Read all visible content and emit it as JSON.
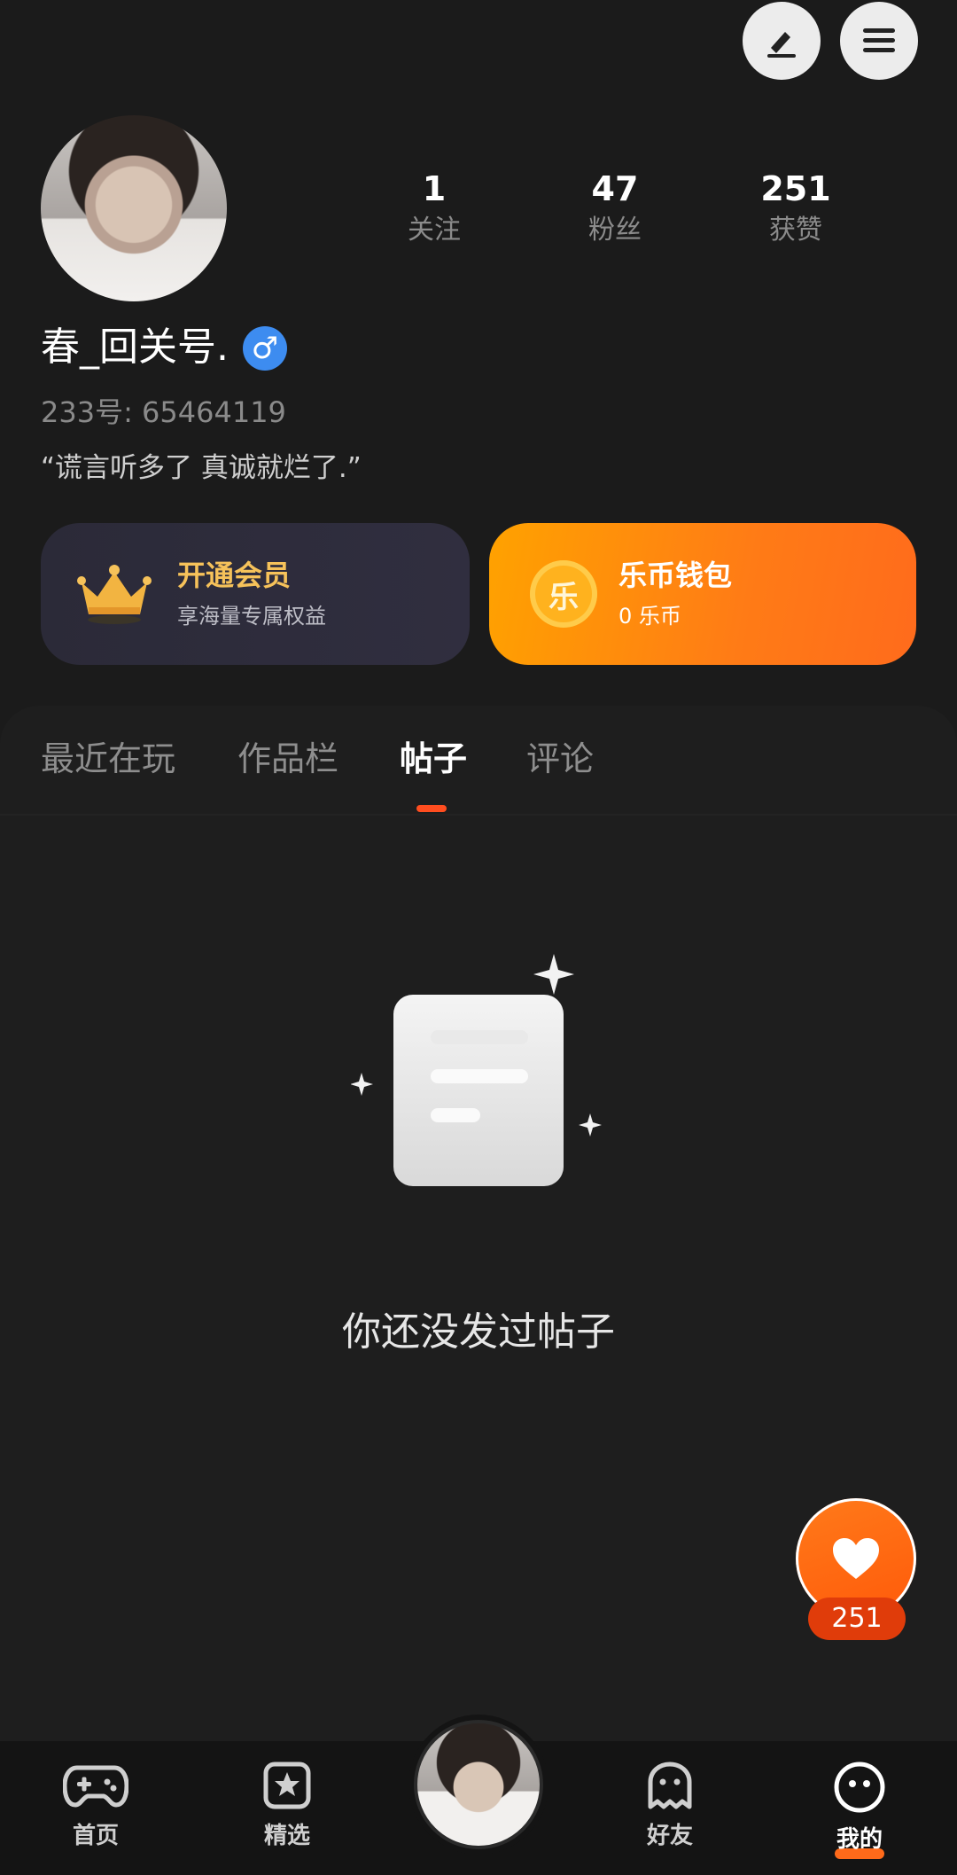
{
  "header": {
    "edit_icon": "edit-icon",
    "menu_icon": "menu-icon"
  },
  "profile": {
    "stats": [
      {
        "value": "1",
        "label": "关注"
      },
      {
        "value": "47",
        "label": "粉丝"
      },
      {
        "value": "251",
        "label": "获赞"
      }
    ],
    "username": "春_回关号.",
    "gender": "male",
    "gender_symbol": "♂",
    "uid": "233号: 65464119",
    "bio": "“谎言听多了 真诚就烂了.”"
  },
  "cards": {
    "vip": {
      "title": "开通会员",
      "subtitle": "享海量专属权益"
    },
    "wallet": {
      "title": "乐币钱包",
      "subtitle": "0 乐币",
      "coin_text": "乐"
    }
  },
  "tabs": [
    {
      "label": "最近在玩",
      "active": false
    },
    {
      "label": "作品栏",
      "active": false
    },
    {
      "label": "帖子",
      "active": true
    },
    {
      "label": "评论",
      "active": false
    }
  ],
  "empty_state": {
    "message": "你还没发过帖子"
  },
  "like_fab": {
    "count": "251"
  },
  "bottom_nav": [
    {
      "label": "首页",
      "icon": "gamepad-icon",
      "active": false
    },
    {
      "label": "精选",
      "icon": "star-badge-icon",
      "active": false
    },
    {
      "label": "",
      "icon": "avatar",
      "active": false
    },
    {
      "label": "好友",
      "icon": "ghost-icon",
      "active": false
    },
    {
      "label": "我的",
      "icon": "smiley-icon",
      "active": true
    }
  ],
  "colors": {
    "background": "#1b1b1b",
    "accent_orange": "#ff7b16",
    "tab_indicator": "#ff4d1f",
    "vip_gold": "#f6c25a",
    "gender_blue": "#3d8cf0"
  }
}
